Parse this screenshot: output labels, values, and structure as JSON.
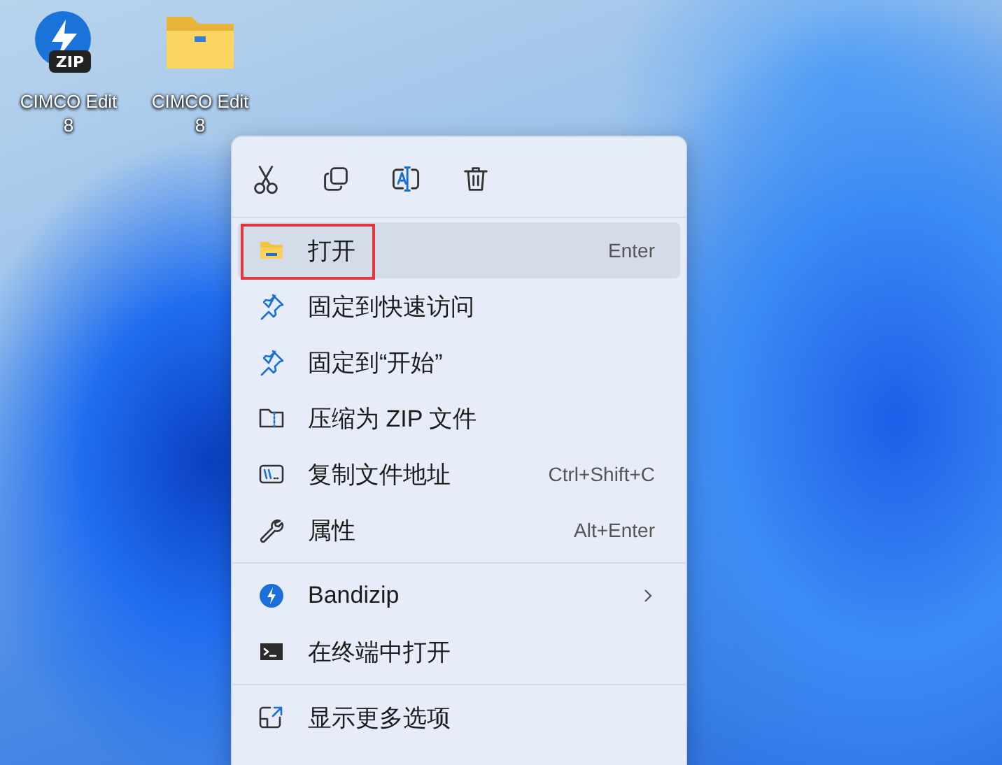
{
  "desktop_icons": [
    {
      "kind": "zip",
      "badge": "ZIP",
      "label": "CIMCO Edit 8"
    },
    {
      "kind": "folder",
      "label": "CIMCO Edit 8"
    }
  ],
  "context_menu": {
    "toolbar": [
      {
        "kind": "cut"
      },
      {
        "kind": "copy"
      },
      {
        "kind": "rename"
      },
      {
        "kind": "delete"
      }
    ],
    "sections": [
      {
        "items": [
          {
            "kind": "folder",
            "label": "打开",
            "shortcut": "Enter",
            "selected": true,
            "marked": true
          },
          {
            "kind": "pin",
            "label": "固定到快速访问",
            "selected": false
          },
          {
            "kind": "pin",
            "label": "固定到“开始”",
            "selected": false
          },
          {
            "kind": "zip",
            "label": "压缩为 ZIP 文件",
            "selected": false
          },
          {
            "kind": "path",
            "label": "复制文件地址",
            "shortcut": "Ctrl+Shift+C",
            "selected": false
          },
          {
            "kind": "wrench",
            "label": "属性",
            "shortcut": "Alt+Enter",
            "selected": false
          }
        ]
      },
      {
        "items": [
          {
            "kind": "bandizip",
            "label": "Bandizip",
            "submenu": true,
            "selected": false
          },
          {
            "kind": "terminal",
            "label": "在终端中打开",
            "selected": false
          }
        ]
      },
      {
        "items": [
          {
            "kind": "more",
            "label": "显示更多选项",
            "selected": false
          }
        ]
      }
    ]
  }
}
